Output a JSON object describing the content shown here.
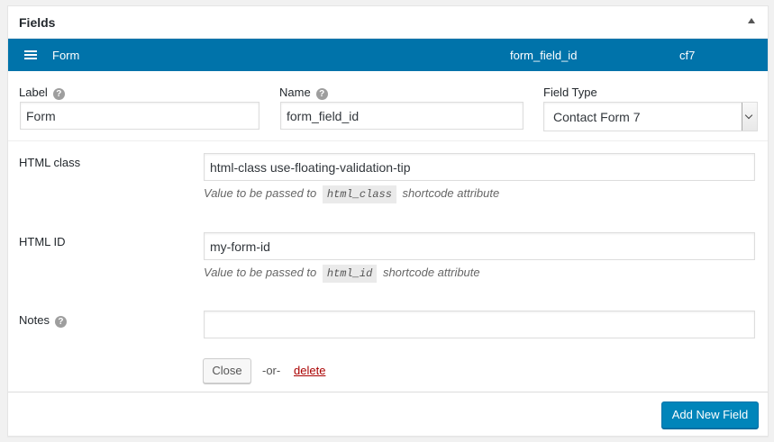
{
  "panel": {
    "title": "Fields",
    "collapse_icon": "triangle-up-icon"
  },
  "field_bar": {
    "menu_icon": "hamburger-icon",
    "label": "Form",
    "name": "form_field_id",
    "type": "cf7",
    "background_color": "#0073aa"
  },
  "form": {
    "label": {
      "title": "Label",
      "value": "Form",
      "help_icon": "question-mark-icon"
    },
    "name": {
      "title": "Name",
      "value": "form_field_id",
      "help_icon": "question-mark-icon"
    },
    "field_type": {
      "title": "Field Type",
      "selected": "Contact Form 7"
    },
    "html_class": {
      "title": "HTML class",
      "value": "html-class use-floating-validation-tip",
      "desc_before": "Value to be passed to",
      "desc_code": "html_class",
      "desc_after": "shortcode attribute"
    },
    "html_id": {
      "title": "HTML ID",
      "value": "my-form-id",
      "desc_before": "Value to be passed to",
      "desc_code": "html_id",
      "desc_after": "shortcode attribute"
    },
    "notes": {
      "title": "Notes",
      "value": "",
      "help_icon": "question-mark-icon"
    }
  },
  "actions": {
    "close_label": "Close",
    "or_label": "-or-",
    "delete_label": "delete",
    "add_new_label": "Add New Field",
    "delete_color": "#a00",
    "primary_color": "#0085ba"
  }
}
